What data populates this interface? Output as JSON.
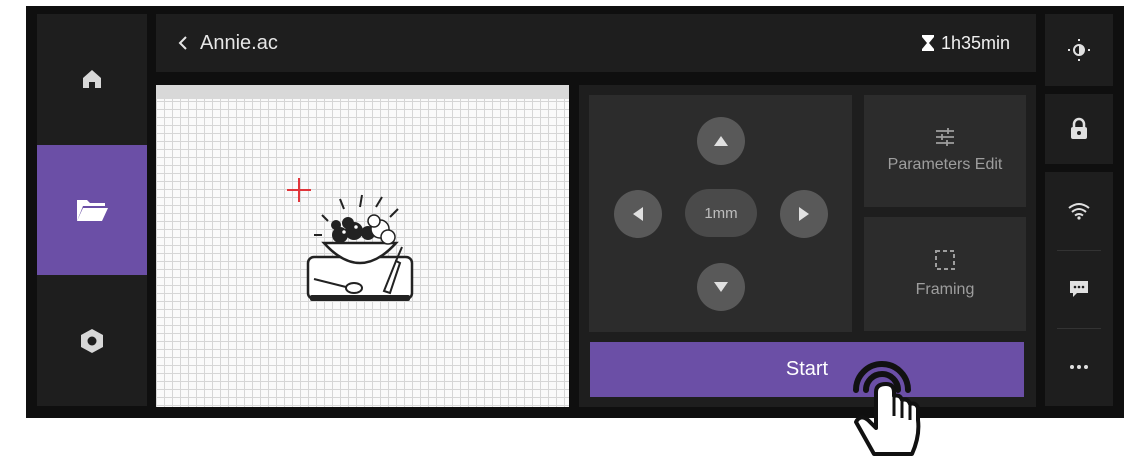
{
  "header": {
    "back_label": "Annie.ac",
    "timer": "1h35min"
  },
  "nav": {
    "items": [
      {
        "icon": "home-icon",
        "active": false
      },
      {
        "icon": "folder-icon",
        "active": true
      },
      {
        "icon": "settings-hexagon-icon",
        "active": false
      }
    ]
  },
  "jog": {
    "step": "1mm",
    "directions": [
      "up",
      "left",
      "right",
      "down"
    ]
  },
  "actions": {
    "parameters_edit": "Parameters Edit",
    "framing": "Framing",
    "start": "Start"
  },
  "side_controls": [
    "brightness-icon",
    "lock-icon",
    "wifi-icon",
    "message-icon",
    "more-icon"
  ],
  "colors": {
    "accent": "#6b4fa6",
    "panel": "#1e1e1e",
    "tile": "#2c2c2c",
    "crosshair": "#e0353a"
  }
}
